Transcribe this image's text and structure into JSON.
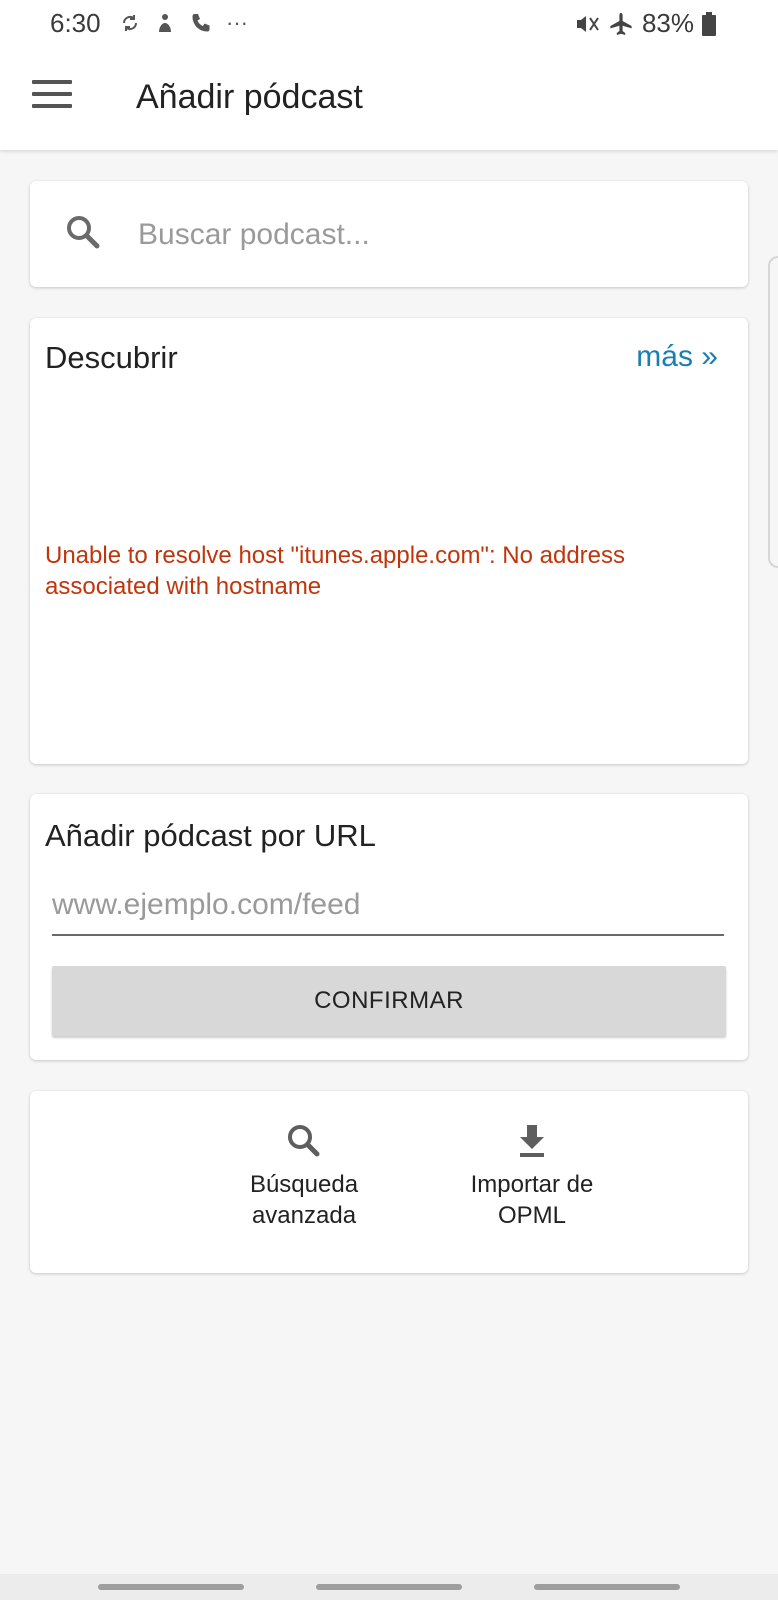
{
  "status_bar": {
    "time": "6:30",
    "more": "···",
    "battery": "83%"
  },
  "app_bar": {
    "title": "Añadir pódcast"
  },
  "search": {
    "placeholder": "Buscar podcast..."
  },
  "discover": {
    "title": "Descubrir",
    "more_link": "más »",
    "error": "Unable to resolve host \"itunes.apple.com\": No address associated with hostname",
    "error_color": "#c0360c",
    "link_color": "#1a7fb0"
  },
  "add_by_url": {
    "title": "Añadir pódcast por URL",
    "placeholder": "www.ejemplo.com/feed",
    "confirm_label": "CONFIRMAR"
  },
  "actions": {
    "advanced_search": {
      "label_line1": "Búsqueda",
      "label_line2": "avanzada",
      "icon": "search-icon"
    },
    "import_opml": {
      "label_line1": "Importar de",
      "label_line2": "OPML",
      "icon": "download-icon"
    }
  }
}
